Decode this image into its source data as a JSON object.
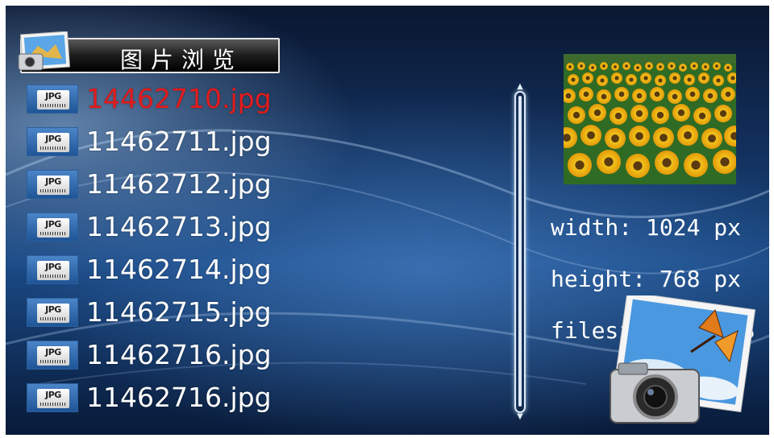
{
  "header": {
    "title": "图片浏览"
  },
  "files": [
    {
      "name": "14462710.jpg",
      "selected": true
    },
    {
      "name": "11462711.jpg",
      "selected": false
    },
    {
      "name": "11462712.jpg",
      "selected": false
    },
    {
      "name": "11462713.jpg",
      "selected": false
    },
    {
      "name": "11462714.jpg",
      "selected": false
    },
    {
      "name": "11462715.jpg",
      "selected": false
    },
    {
      "name": "11462716.jpg",
      "selected": false
    },
    {
      "name": "11462716.jpg",
      "selected": false
    }
  ],
  "file_icon_label": "JPG",
  "info": {
    "width": "width: 1024 px",
    "height": "height: 768 px",
    "filesize": "filesize:185 KB"
  },
  "colors": {
    "selected_text": "#e31b1b",
    "normal_text": "#ffffff",
    "background": "#1b4a86"
  },
  "icons": {
    "title_icon": "picture-icon",
    "file_icon": "jpg-file-icon",
    "decor_icon": "camera-photo-icon"
  }
}
